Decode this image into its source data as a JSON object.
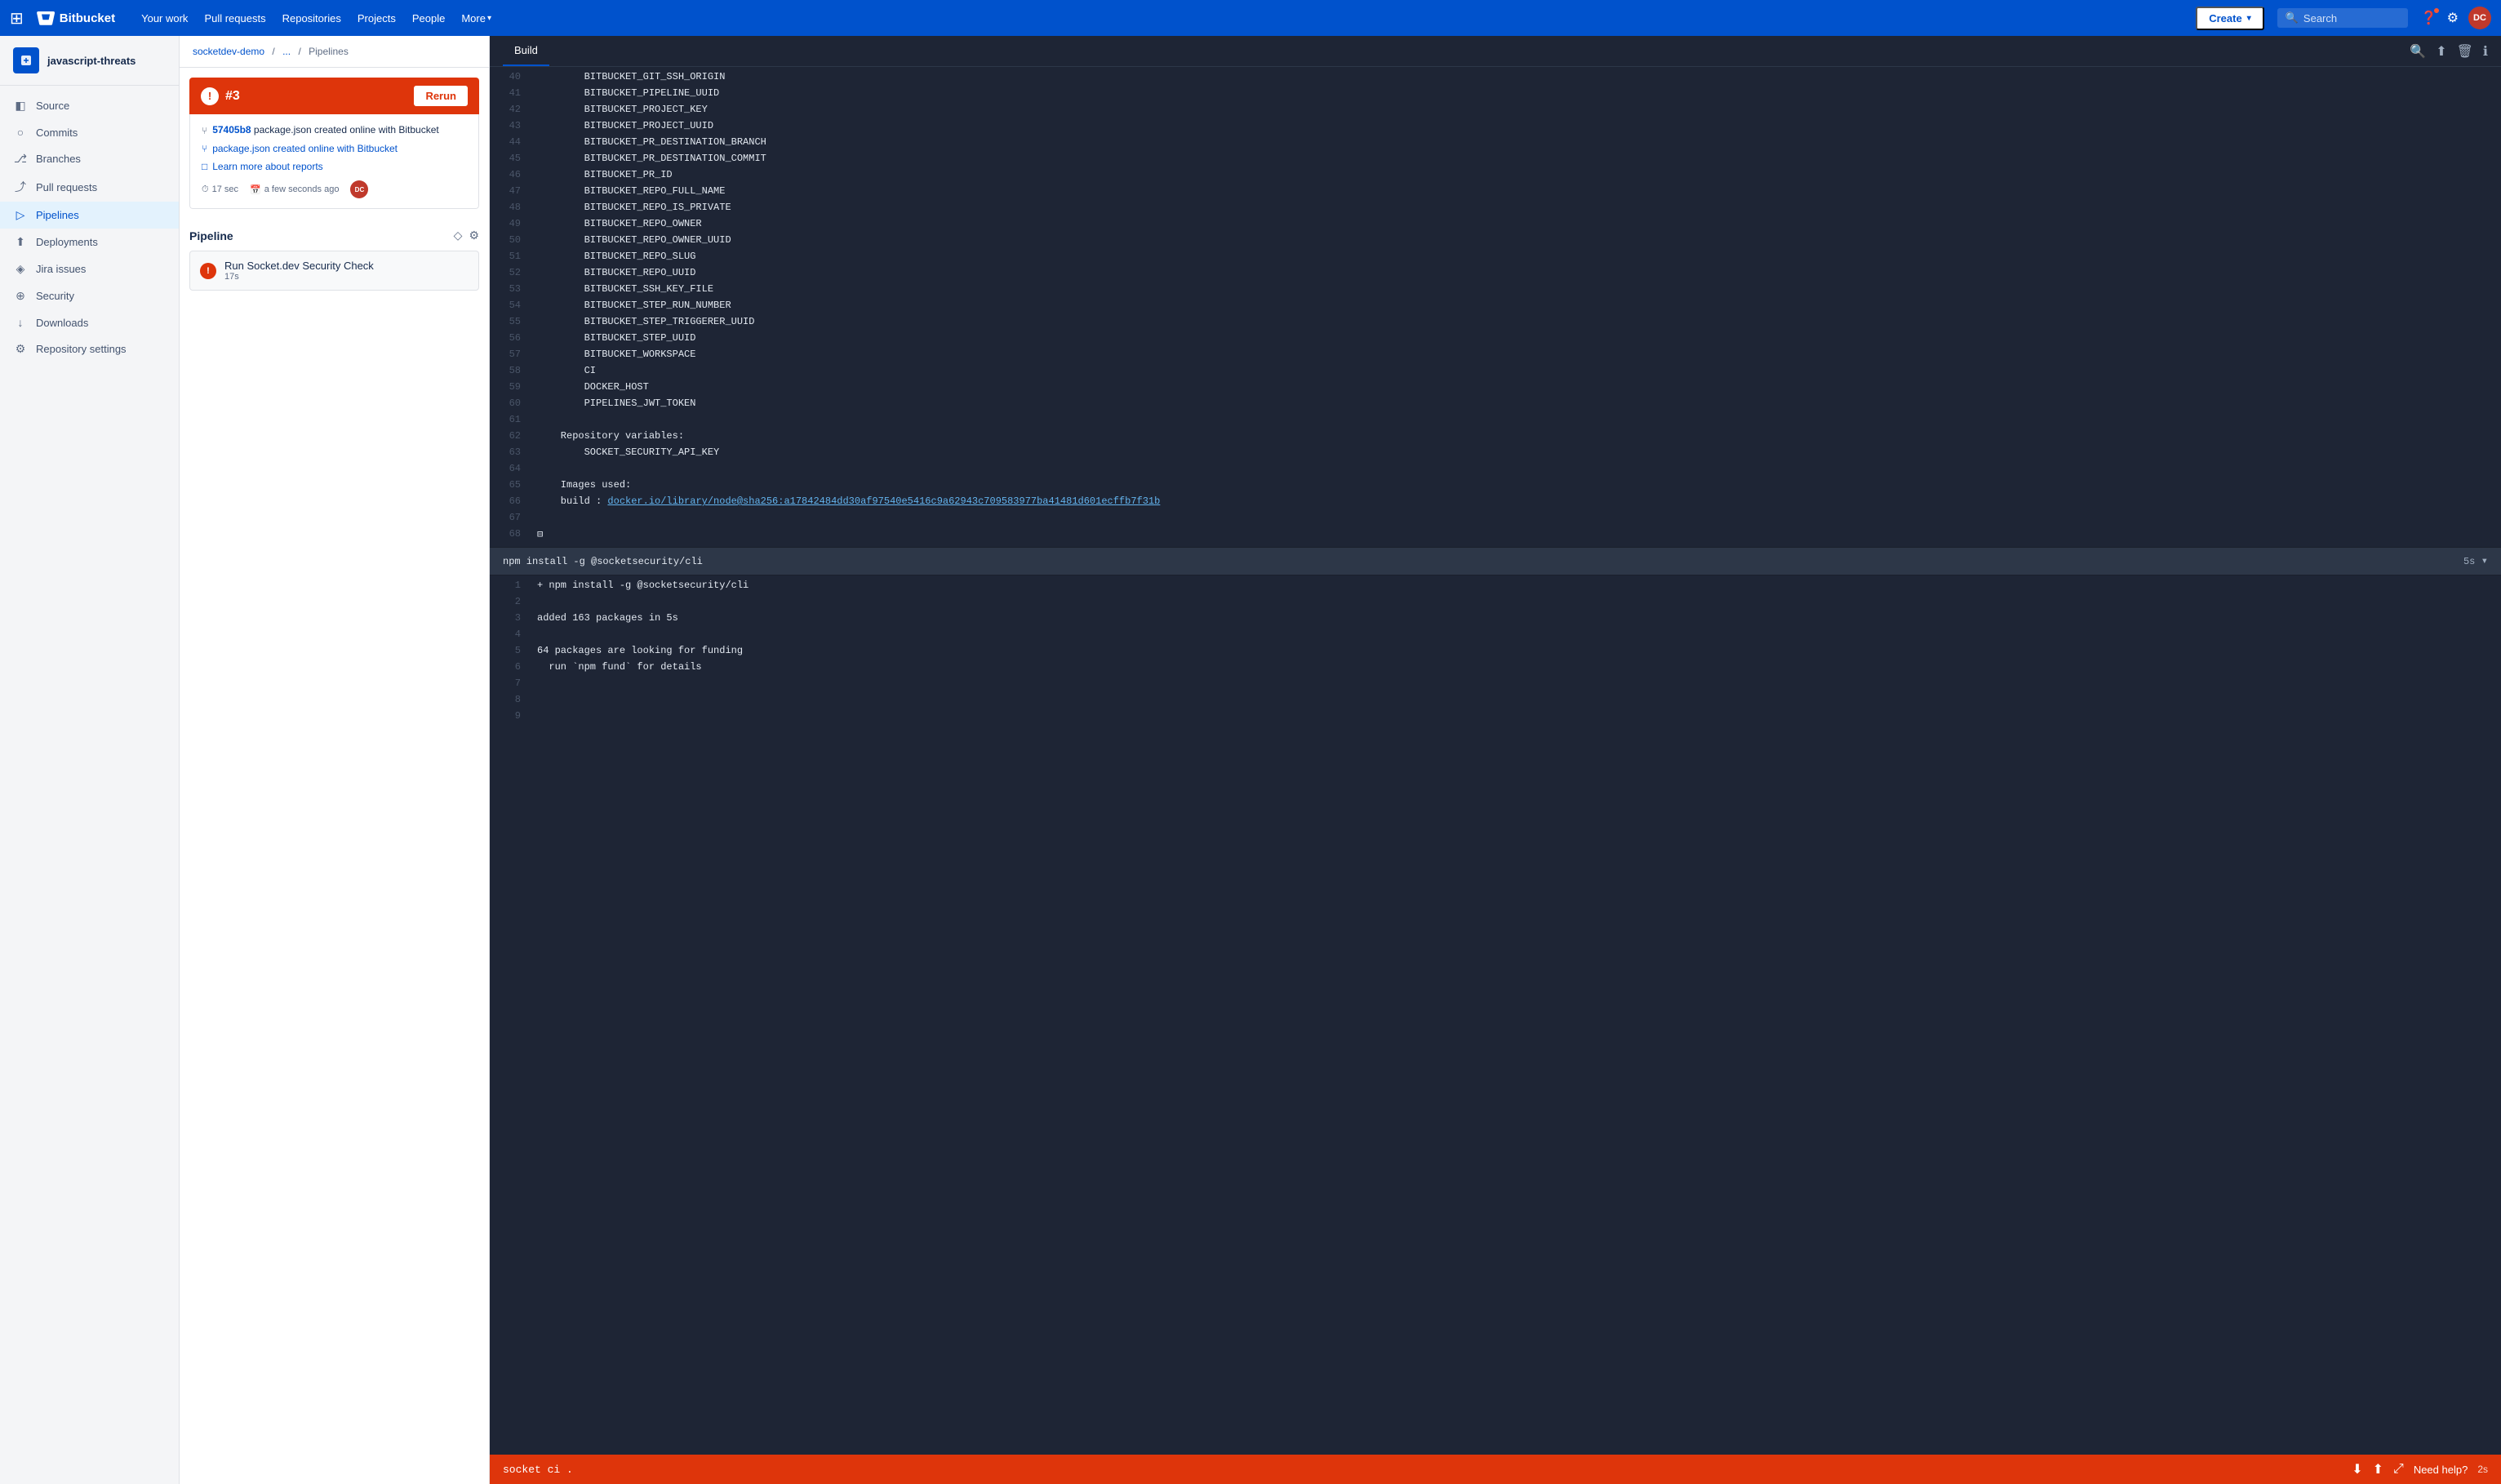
{
  "topnav": {
    "logo_text": "Bitbucket",
    "links": [
      "Your work",
      "Pull requests",
      "Repositories",
      "Projects",
      "People",
      "More"
    ],
    "create_label": "Create",
    "search_placeholder": "Search",
    "avatar_initials": "DC"
  },
  "sidebar": {
    "repo_name": "javascript-threats",
    "items": [
      {
        "id": "source",
        "label": "Source",
        "icon": "⬡"
      },
      {
        "id": "commits",
        "label": "Commits",
        "icon": "○"
      },
      {
        "id": "branches",
        "label": "Branches",
        "icon": "⑂"
      },
      {
        "id": "pull-requests",
        "label": "Pull requests",
        "icon": "⎇"
      },
      {
        "id": "pipelines",
        "label": "Pipelines",
        "icon": "⊡",
        "active": true
      },
      {
        "id": "deployments",
        "label": "Deployments",
        "icon": "⇧"
      },
      {
        "id": "jira-issues",
        "label": "Jira issues",
        "icon": "◈"
      },
      {
        "id": "security",
        "label": "Security",
        "icon": "⊕"
      },
      {
        "id": "downloads",
        "label": "Downloads",
        "icon": "↓"
      },
      {
        "id": "repo-settings",
        "label": "Repository settings",
        "icon": "⚙"
      }
    ]
  },
  "breadcrumb": {
    "parts": [
      "socketdev-demo",
      "...",
      "Pipelines"
    ]
  },
  "build": {
    "number": "#3",
    "rerun_label": "Rerun",
    "commit_hash": "57405b8",
    "commit_message": "package.json created online with Bitbucket",
    "link_label": "package.json created online with Bitbucket",
    "report_label": "Learn more about reports",
    "duration": "17 sec",
    "time_ago": "a few seconds ago",
    "avatar_initials": "DC"
  },
  "pipeline": {
    "title": "Pipeline",
    "step_name": "Run Socket.dev Security Check",
    "step_time": "17s"
  },
  "build_log": {
    "tab_label": "Build",
    "lines": [
      {
        "num": "40",
        "text": "        BITBUCKET_GIT_SSH_ORIGIN"
      },
      {
        "num": "41",
        "text": "        BITBUCKET_PIPELINE_UUID"
      },
      {
        "num": "42",
        "text": "        BITBUCKET_PROJECT_KEY"
      },
      {
        "num": "43",
        "text": "        BITBUCKET_PROJECT_UUID"
      },
      {
        "num": "44",
        "text": "        BITBUCKET_PR_DESTINATION_BRANCH"
      },
      {
        "num": "45",
        "text": "        BITBUCKET_PR_DESTINATION_COMMIT"
      },
      {
        "num": "46",
        "text": "        BITBUCKET_PR_ID"
      },
      {
        "num": "47",
        "text": "        BITBUCKET_REPO_FULL_NAME"
      },
      {
        "num": "48",
        "text": "        BITBUCKET_REPO_IS_PRIVATE"
      },
      {
        "num": "49",
        "text": "        BITBUCKET_REPO_OWNER"
      },
      {
        "num": "50",
        "text": "        BITBUCKET_REPO_OWNER_UUID"
      },
      {
        "num": "51",
        "text": "        BITBUCKET_REPO_SLUG"
      },
      {
        "num": "52",
        "text": "        BITBUCKET_REPO_UUID"
      },
      {
        "num": "53",
        "text": "        BITBUCKET_SSH_KEY_FILE"
      },
      {
        "num": "54",
        "text": "        BITBUCKET_STEP_RUN_NUMBER"
      },
      {
        "num": "55",
        "text": "        BITBUCKET_STEP_TRIGGERER_UUID"
      },
      {
        "num": "56",
        "text": "        BITBUCKET_STEP_UUID"
      },
      {
        "num": "57",
        "text": "        BITBUCKET_WORKSPACE"
      },
      {
        "num": "58",
        "text": "        CI"
      },
      {
        "num": "59",
        "text": "        DOCKER_HOST"
      },
      {
        "num": "60",
        "text": "        PIPELINES_JWT_TOKEN"
      },
      {
        "num": "61",
        "text": ""
      },
      {
        "num": "62",
        "text": "    Repository variables:"
      },
      {
        "num": "63",
        "text": "        SOCKET_SECURITY_API_KEY"
      },
      {
        "num": "64",
        "text": ""
      },
      {
        "num": "65",
        "text": "    Images used:"
      },
      {
        "num": "66",
        "text": "    build : docker.io/library/node@sha256:a17842484dd30af97540e5416c9a62943c709583977ba41481d601ecffb7f31b",
        "has_link": true
      },
      {
        "num": "67",
        "text": ""
      },
      {
        "num": "68",
        "text": "⊟"
      }
    ],
    "step_cmd": "npm install -g @socketsecurity/cli",
    "step_time": "5s",
    "sub_lines": [
      {
        "num": "1",
        "text": "+ npm install -g @socketsecurity/cli"
      },
      {
        "num": "2",
        "text": ""
      },
      {
        "num": "3",
        "text": "added 163 packages in 5s"
      },
      {
        "num": "4",
        "text": ""
      },
      {
        "num": "5",
        "text": "64 packages are looking for funding"
      },
      {
        "num": "6",
        "text": "  run `npm fund` for details"
      },
      {
        "num": "7",
        "text": ""
      },
      {
        "num": "8",
        "text": ""
      },
      {
        "num": "9",
        "text": ""
      }
    ]
  },
  "bottom_bar": {
    "cmd": "socket ci .",
    "help_label": "Need help?",
    "time": "2s"
  }
}
